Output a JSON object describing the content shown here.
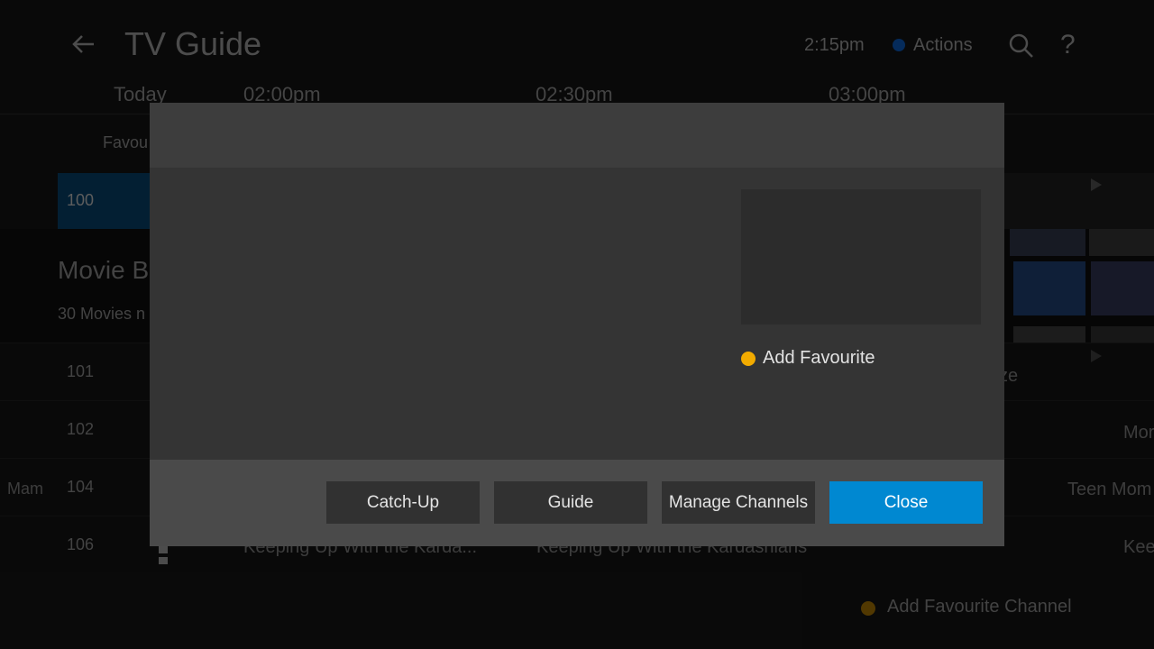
{
  "header": {
    "title": "TV Guide",
    "time": "2:15pm",
    "actions_label": "Actions",
    "help_glyph": "?"
  },
  "timeline": {
    "day": "Today",
    "slots": [
      "02:00pm",
      "02:30pm",
      "03:00pm"
    ]
  },
  "guide": {
    "favourites_label": "Favou",
    "channels": [
      {
        "number": "100"
      },
      {
        "number": "101"
      },
      {
        "number": "102"
      },
      {
        "number": "104"
      },
      {
        "number": "106"
      }
    ],
    "featured_title": "Movie B",
    "featured_sub": "30 Movies n",
    "programs": {
      "row101_right": "ze",
      "row102_right": "Mor",
      "row104_left": "Mam",
      "row104_right": "Teen Mom",
      "row106_a": "Keeping Up With the Karda...",
      "row106_b": "Keeping Up With the Kardashians",
      "row106_right": "Kee"
    },
    "footer_hint": "Add Favourite Channel"
  },
  "modal": {
    "favourite_label": "Add Favourite",
    "buttons": {
      "catchup": "Catch-Up",
      "guide": "Guide",
      "manage": "Manage Channels",
      "close": "Close"
    }
  },
  "colors": {
    "primary_button": "#0088d1",
    "favourite_dot": "#f2ab00",
    "actions_dot": "#0a4fa6"
  }
}
